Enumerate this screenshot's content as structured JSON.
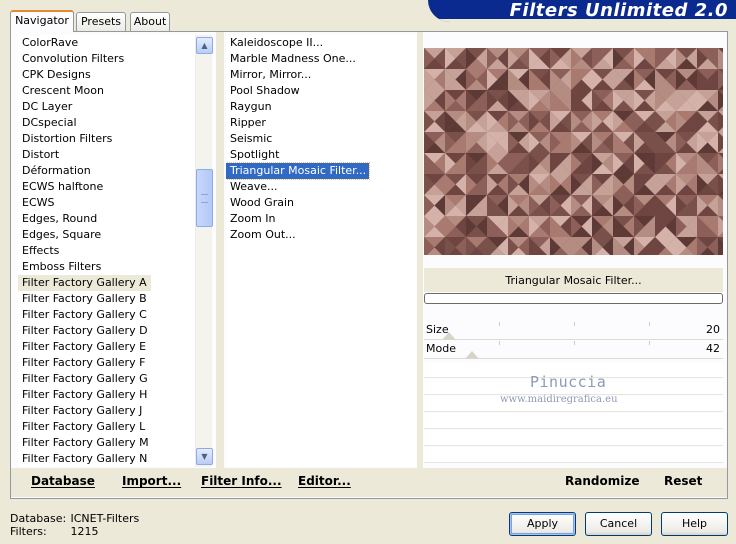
{
  "banner": {
    "title": "Filters Unlimited 2.0"
  },
  "tabs": [
    {
      "label": "Navigator",
      "active": true
    },
    {
      "label": "Presets",
      "active": false
    },
    {
      "label": "About",
      "active": false
    }
  ],
  "categories": {
    "items": [
      "ColorRave",
      "Convolution Filters",
      "CPK Designs",
      "Crescent Moon",
      "DC Layer",
      "DCspecial",
      "Distortion Filters",
      "Distort",
      "Déformation",
      "ECWS halftone",
      "ECWS",
      "Edges, Round",
      "Edges, Square",
      "Effects",
      "Emboss Filters",
      "Filter Factory Gallery A",
      "Filter Factory Gallery B",
      "Filter Factory Gallery C",
      "Filter Factory Gallery D",
      "Filter Factory Gallery E",
      "Filter Factory Gallery F",
      "Filter Factory Gallery G",
      "Filter Factory Gallery H",
      "Filter Factory Gallery J",
      "Filter Factory Gallery L",
      "Filter Factory Gallery M",
      "Filter Factory Gallery N"
    ],
    "selected_index": 15
  },
  "filters": {
    "items": [
      "Kaleidoscope II...",
      "Marble Madness One...",
      "Mirror, Mirror...",
      "Pool Shadow",
      "Raygun",
      "Ripper",
      "Seismic",
      "Spotlight",
      "Triangular Mosaic Filter...",
      "Weave...",
      "Wood Grain",
      "Zoom In",
      "Zoom Out..."
    ],
    "selected_index": 8
  },
  "preview": {
    "filter_name": "Triangular Mosaic Filter...",
    "colors": [
      "#6e4540",
      "#8c5f58",
      "#a87a70",
      "#c6a198",
      "#7a504a",
      "#b58c82",
      "#5e3a36",
      "#d4b2aa"
    ]
  },
  "params": [
    {
      "label": "Size",
      "value": "20"
    },
    {
      "label": "Mode",
      "value": "42"
    }
  ],
  "watermark": {
    "line1": "Pinuccia",
    "line2": "www.maidiregrafica.eu"
  },
  "toolbar": {
    "database": "Database",
    "import": "Import...",
    "filter_info": "Filter Info...",
    "editor": "Editor...",
    "randomize": "Randomize",
    "reset": "Reset"
  },
  "status": {
    "database_label": "Database:",
    "database_value": "ICNET-Filters",
    "filters_label": "Filters:",
    "filters_value": "1215"
  },
  "buttons": {
    "apply": "Apply",
    "cancel": "Cancel",
    "help": "Help"
  }
}
